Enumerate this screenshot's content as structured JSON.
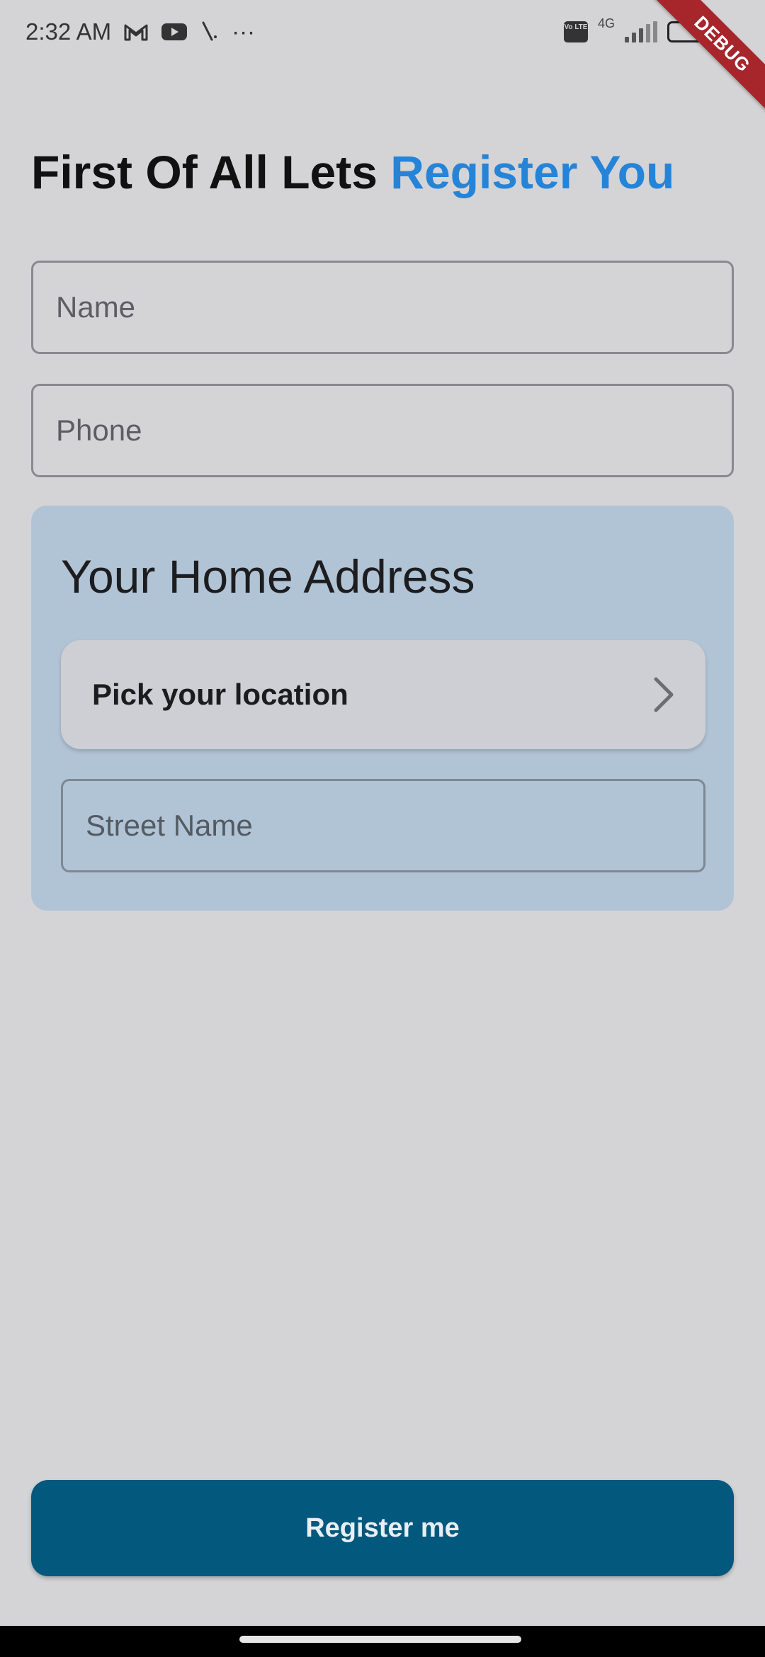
{
  "status_bar": {
    "time": "2:32 AM",
    "more": "···",
    "network_type": "4G",
    "volte_label": "Vo LTE",
    "icons": [
      "gmail-icon",
      "youtube-icon",
      "app-icon",
      "volte-icon",
      "signal-icon",
      "battery-icon"
    ]
  },
  "debug_banner": {
    "label": "DEBUG"
  },
  "header": {
    "title_prefix": "First Of All Lets ",
    "title_accent": "Register You",
    "accent_color": "#2584d8"
  },
  "form": {
    "name_placeholder": "Name",
    "phone_placeholder": "Phone"
  },
  "address": {
    "title": "Your Home Address",
    "pick_location_label": "Pick your location",
    "street_placeholder": "Street Name",
    "card_color": "#b1c4d6"
  },
  "actions": {
    "register_label": "Register me",
    "button_color": "#02587d"
  }
}
